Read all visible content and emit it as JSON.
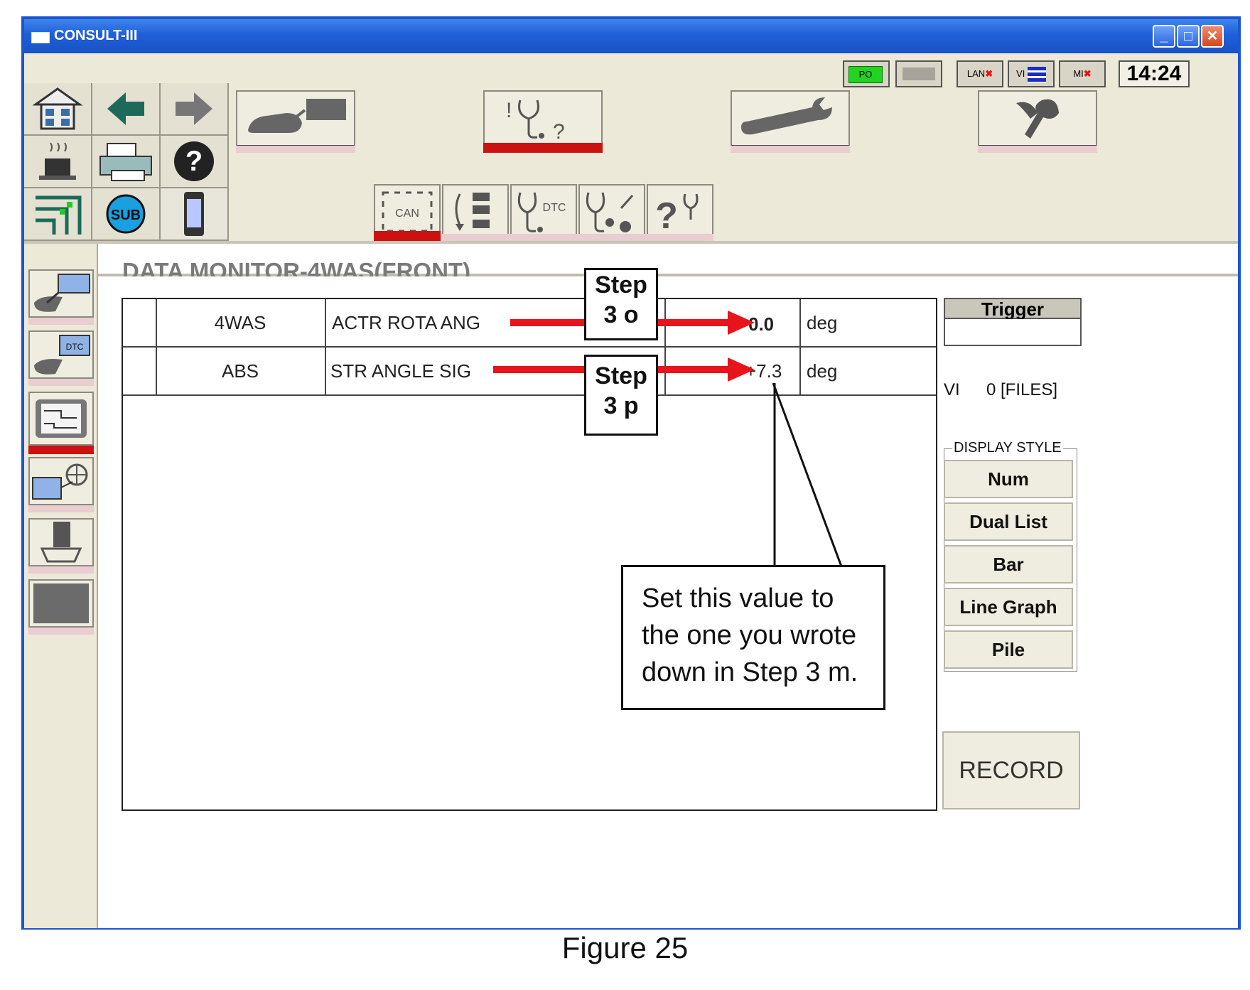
{
  "window": {
    "title": "CONSULT-III"
  },
  "status": {
    "po": "PO",
    "lan": "LAN",
    "vi": "VI",
    "mi": "MI",
    "clock": "14:24"
  },
  "page": {
    "title": "DATA MONITOR-4WAS(FRONT)"
  },
  "table": {
    "rows": [
      {
        "system": "4WAS",
        "item": "ACTR ROTA ANG",
        "value": "0.0",
        "unit": "deg"
      },
      {
        "system": "ABS",
        "item": "STR ANGLE SIG",
        "value": "+7.3",
        "unit": "deg"
      }
    ]
  },
  "right_panel": {
    "trigger_label": "Trigger",
    "vi_label": "VI",
    "files": "0 [FILES]",
    "display_style_label": "DISPLAY STYLE",
    "display_styles": [
      "Num",
      "Dual List",
      "Bar",
      "Line Graph",
      "Pile"
    ],
    "record_label": "RECORD"
  },
  "icons": {
    "can": "CAN",
    "dtc": "DTC",
    "dtc_side": "DTC",
    "sub": "SUB"
  },
  "annotations": {
    "step_3o_line1": "Step",
    "step_3o_line2": "3 o",
    "step_3p_line1": "Step",
    "step_3p_line2": "3 p",
    "note_line1": "Set this value to",
    "note_line2": "the one you wrote",
    "note_line3": "down in Step 3 m."
  },
  "caption": "Figure 25",
  "colors": {
    "titlebar": "#1f5fd8",
    "arrow_red": "#e8141b",
    "selected_red": "#cc1111"
  }
}
